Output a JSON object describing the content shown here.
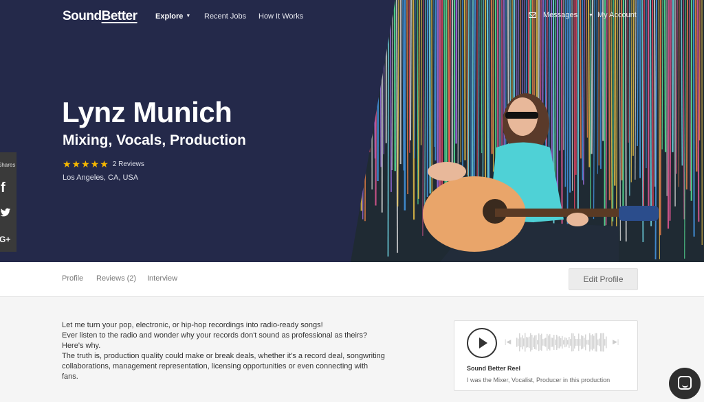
{
  "nav": {
    "logo": "SoundBetter",
    "logo_part1": "Sound",
    "logo_part2": "Better",
    "explore": "Explore",
    "recent_jobs": "Recent Jobs",
    "how_it_works": "How It Works",
    "messages": "Messages",
    "my_account": "My Account"
  },
  "profile": {
    "name": "Lynz Munich",
    "tagline": "Mixing, Vocals, Production",
    "stars": "★★★★★",
    "rating_value": 5,
    "reviews": "2 Reviews",
    "location": "Los Angeles, CA, USA"
  },
  "share": {
    "label": "Shares",
    "facebook": "f",
    "google_plus": "G+"
  },
  "tabs": [
    {
      "label": "Profile"
    },
    {
      "label": "Reviews (2)"
    },
    {
      "label": "Interview"
    }
  ],
  "edit_profile": "Edit Profile",
  "about": {
    "heading": "Let me turn your pop, electronic, or hip-hop recordings into radio-ready songs!",
    "p1": "Ever listen to the radio and wonder why your records don't sound as professional as theirs?",
    "p2": "Here's why.",
    "p3": "The truth is, production quality could make or break deals, whether it's a record deal, songwriting collaborations, management representation, licensing opportunities or even connecting with fans."
  },
  "player": {
    "title": "Sound Better Reel",
    "credit": "I was the Mixer, Vocalist, Producer in this production"
  },
  "colors": {
    "hero_bg": "#24294a",
    "star": "#f5b700",
    "chat_bg": "#2e2e2e"
  },
  "icons": {
    "mail": "mail-icon",
    "play": "play-icon",
    "chat": "chat-icon",
    "twitter": "twitter-icon",
    "facebook": "facebook-icon",
    "google_plus": "google-plus-icon"
  }
}
